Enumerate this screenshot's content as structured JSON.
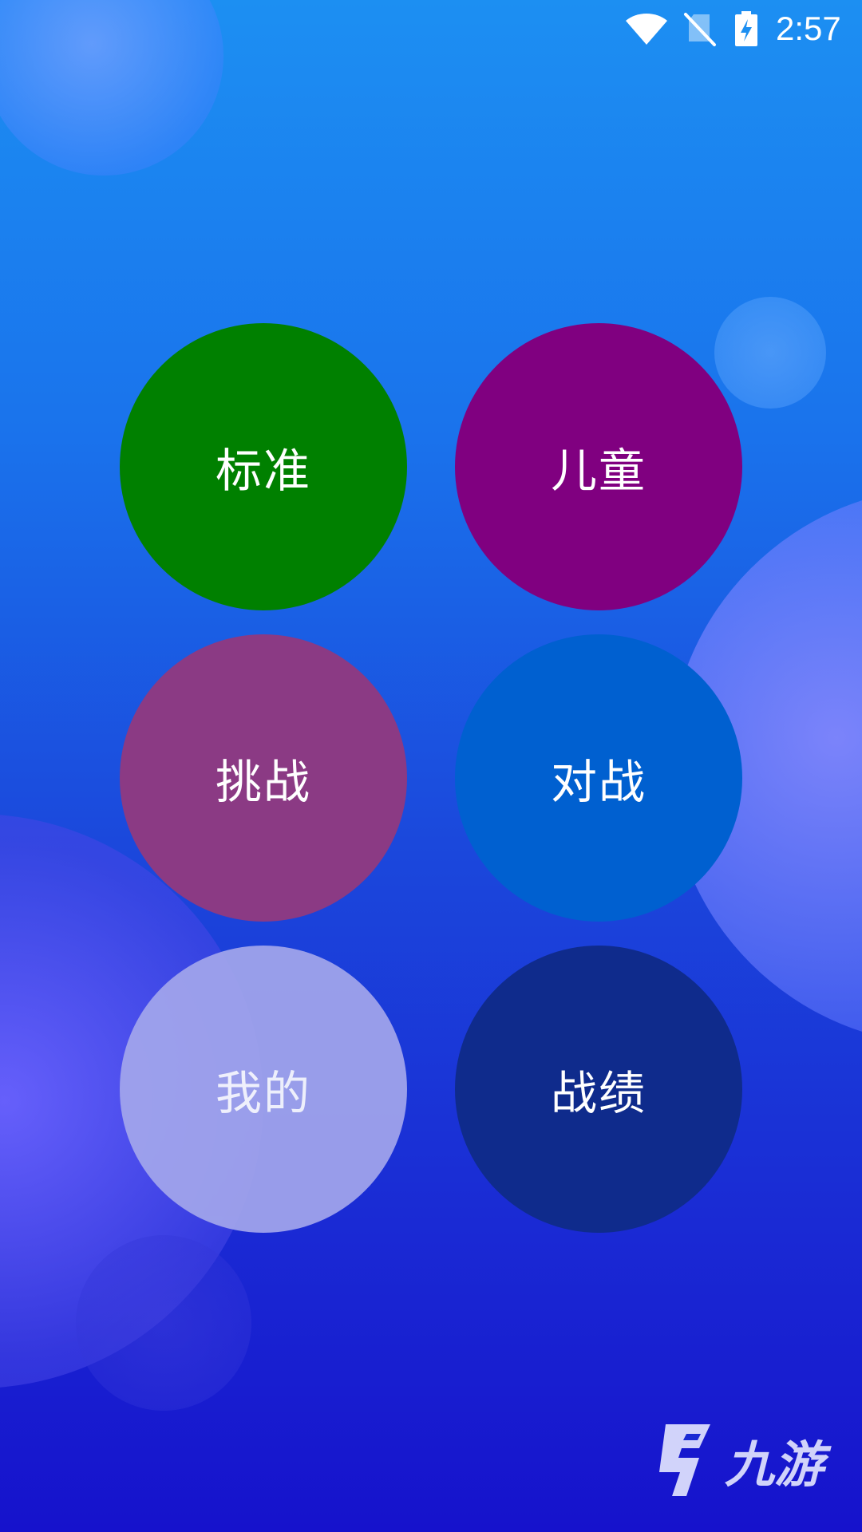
{
  "status_bar": {
    "time": "2:57",
    "icons": [
      "wifi-icon",
      "no-sim-icon",
      "battery-charging-icon"
    ]
  },
  "menu": {
    "items": [
      {
        "id": "standard",
        "label": "标准",
        "color": "#008000"
      },
      {
        "id": "children",
        "label": "儿童",
        "color": "#800080"
      },
      {
        "id": "challenge",
        "label": "挑战",
        "color": "#8b3a84"
      },
      {
        "id": "battle",
        "label": "对战",
        "color": "#0060d0"
      },
      {
        "id": "mine",
        "label": "我的",
        "color": "#a3a6ec"
      },
      {
        "id": "record",
        "label": "战绩",
        "color": "#0f2b8c"
      }
    ]
  },
  "watermark": {
    "text": "九游",
    "icon": "jiuyou-logo-icon"
  },
  "colors": {
    "background_top": "#1c8ff2",
    "background_bottom": "#1612cc",
    "label_text": "#ffffff"
  }
}
